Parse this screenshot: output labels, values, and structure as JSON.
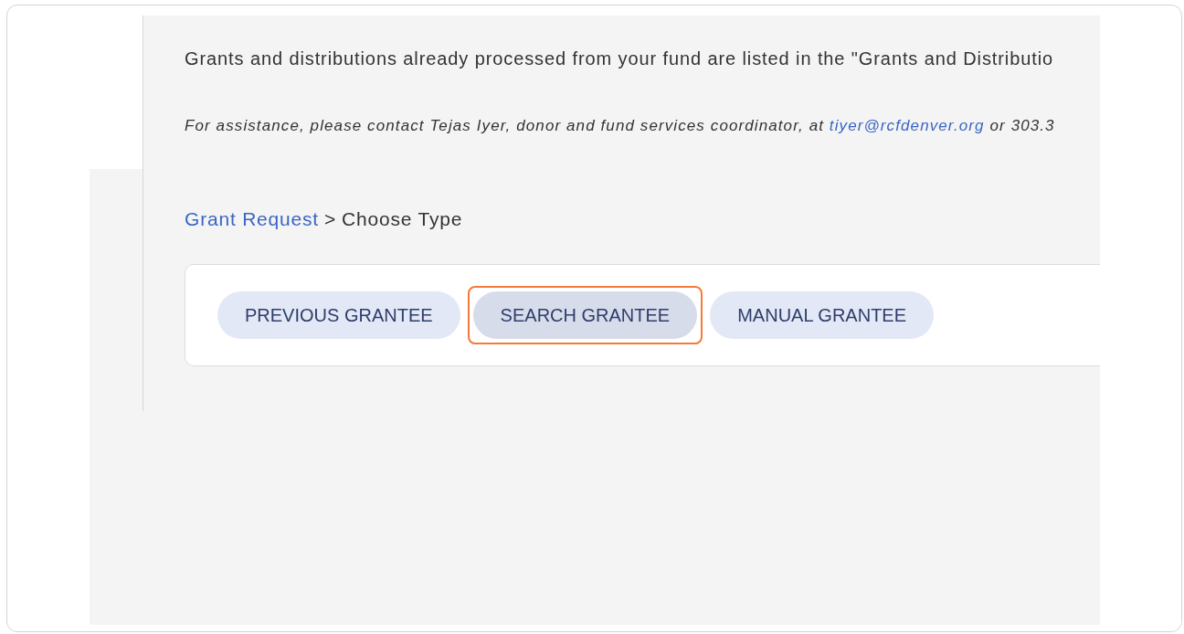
{
  "intro": "Grants and distributions already processed from your fund are listed in the \"Grants and Distributio",
  "assistance": {
    "text": "For assistance, please contact Tejas Iyer, donor and fund services coordinator, at",
    "link": "tiyer@rcfdenver.org",
    "after": "or 303.3"
  },
  "breadcrumb": {
    "link": "Grant Request",
    "separator": ">",
    "current": "Choose Type"
  },
  "options": [
    {
      "label": "PREVIOUS GRANTEE",
      "highlighted": false
    },
    {
      "label": "SEARCH GRANTEE",
      "highlighted": true
    },
    {
      "label": "MANUAL GRANTEE",
      "highlighted": false
    }
  ]
}
